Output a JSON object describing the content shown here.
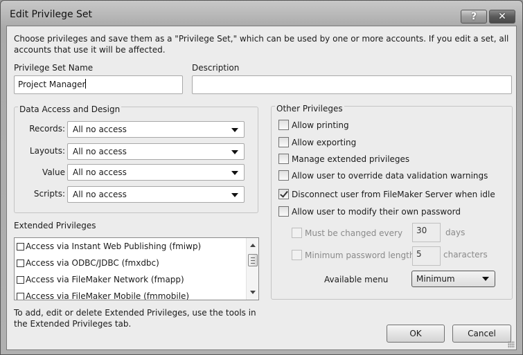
{
  "window": {
    "title": "Edit Privilege Set",
    "help_label": "?",
    "close_label": "✕"
  },
  "intro": "Choose privileges and save them as a \"Privilege Set,\" which can be used by one or more accounts. If you edit a set, all accounts that use it will be affected.",
  "name_field": {
    "label": "Privilege Set Name",
    "value": "Project Manager"
  },
  "description_field": {
    "label": "Description",
    "value": ""
  },
  "data_access": {
    "title": "Data Access and Design",
    "rows": [
      {
        "label": "Records:",
        "value": "All no access"
      },
      {
        "label": "Layouts:",
        "value": "All no access"
      },
      {
        "label": "Value",
        "value": "All no access"
      },
      {
        "label": "Scripts:",
        "value": "All no access"
      }
    ]
  },
  "extended": {
    "title": "Extended Privileges",
    "items": [
      {
        "label": "Access via Instant Web Publishing (fmiwp)",
        "checked": false
      },
      {
        "label": "Access via ODBC/JDBC (fmxdbc)",
        "checked": false
      },
      {
        "label": "Access via FileMaker Network (fmapp)",
        "checked": false
      },
      {
        "label": "Access via FileMaker Mobile (fmmobile)",
        "checked": false
      }
    ],
    "note": "To add, edit or delete Extended Privileges, use the tools in the Extended Privileges tab."
  },
  "other": {
    "title": "Other Privileges",
    "items": [
      {
        "label": "Allow printing",
        "checked": false
      },
      {
        "label": "Allow exporting",
        "checked": false
      },
      {
        "label": "Manage extended privileges",
        "checked": false
      },
      {
        "label": "Allow user to override data validation warnings",
        "checked": false
      },
      {
        "label": "Disconnect user from FileMaker Server when idle",
        "checked": true
      },
      {
        "label": "Allow user to modify their own password",
        "checked": false
      }
    ],
    "must_change": {
      "label": "Must be changed every",
      "value": "30",
      "unit": "days",
      "enabled": false
    },
    "min_length": {
      "label": "Minimum password length",
      "value": "5",
      "unit": "characters",
      "enabled": false
    },
    "available_menu": {
      "label": "Available menu",
      "value": "Minimum"
    }
  },
  "buttons": {
    "ok": "OK",
    "cancel": "Cancel"
  }
}
